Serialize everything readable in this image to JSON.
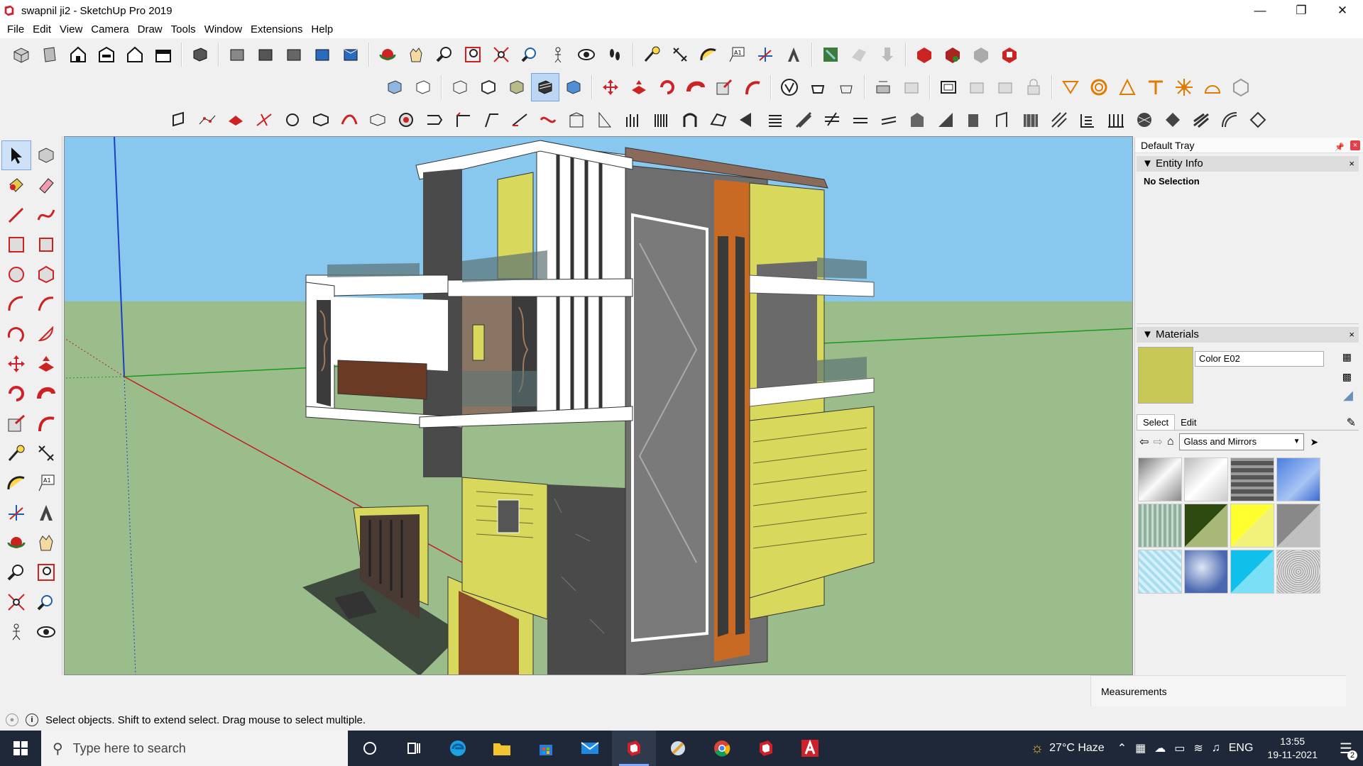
{
  "window": {
    "title": "swapnil ji2 - SketchUp Pro 2019"
  },
  "menu": [
    "File",
    "Edit",
    "View",
    "Camera",
    "Draw",
    "Tools",
    "Window",
    "Extensions",
    "Help"
  ],
  "tray": {
    "title": "Default Tray",
    "entity_info": {
      "title": "Entity Info",
      "value": "No Selection"
    },
    "materials": {
      "title": "Materials",
      "current_name": "Color E02",
      "current_color": "#c8c856",
      "tabs": [
        "Select",
        "Edit"
      ],
      "library": "Glass and Mirrors",
      "swatches": [
        "glass-grey-gradient",
        "glass-light-gradient",
        "glass-tile-grey",
        "glass-blue",
        "glass-green-stripes",
        "glass-dark-green",
        "glass-yellow",
        "glass-grey-diagonal",
        "glass-cyan-pattern",
        "glass-sky-blue",
        "glass-cyan",
        "glass-grey-noise"
      ]
    }
  },
  "measurements_label": "Measurements",
  "status_text": "Select objects. Shift to extend select. Drag mouse to select multiple.",
  "taskbar": {
    "search_placeholder": "Type here to search",
    "weather": "27°C  Haze",
    "language": "ENG",
    "time": "13:55",
    "date": "19-11-2021",
    "notification_count": "2"
  },
  "colors": {
    "sky": "#8cc8f0",
    "ground": "#9bbd8c",
    "wall_yellow": "#d8d85c",
    "accent_red": "#d0202a"
  }
}
